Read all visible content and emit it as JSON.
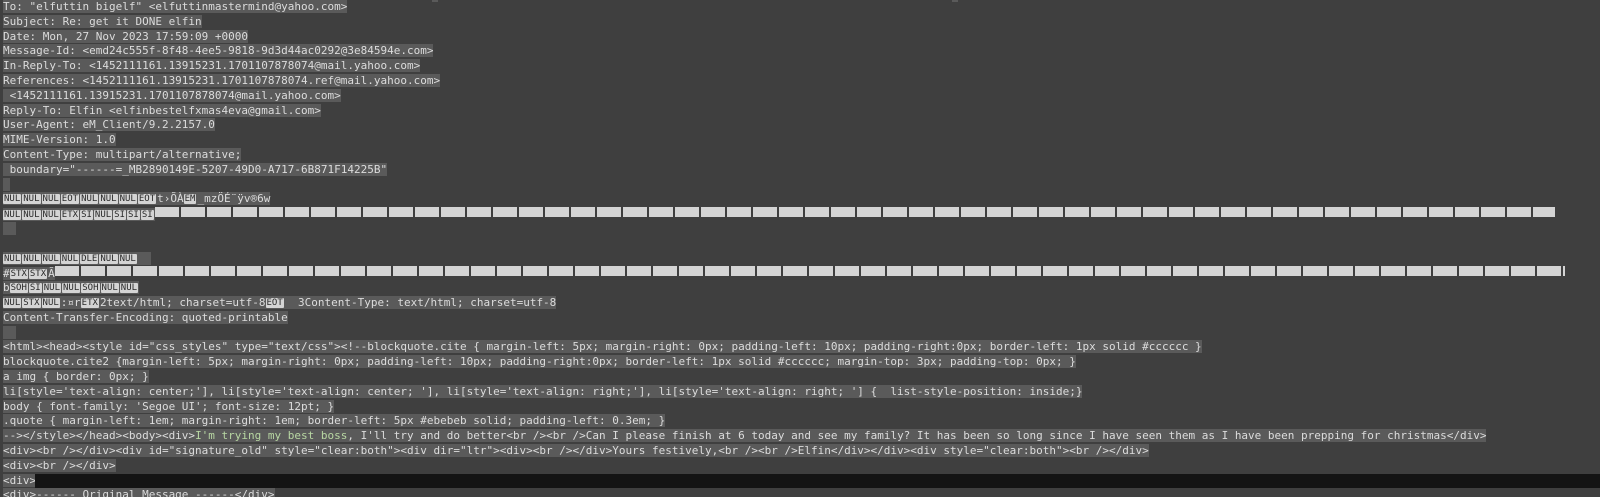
{
  "headers": [
    "To: \"elfuttin bigelf\" <elfuttinmastermind@yahoo.com>",
    "Subject: Re: get it DONE elfin",
    "Date: Mon, 27 Nov 2023 17:59:09 +0000",
    "Message-Id: <emd24c555f-8f48-4ee5-9818-9d3d44ac0292@3e84594e.com>",
    "In-Reply-To: <1452111161.13915231.1701107878074@mail.yahoo.com>",
    "References: <1452111161.13915231.1701107878074.ref@mail.yahoo.com>",
    " <1452111161.13915231.1701107878074@mail.yahoo.com>",
    "Reply-To: Elfin <elfinbestelfxmas4eva@gmail.com>",
    "User-Agent: eM_Client/9.2.2157.0",
    "MIME-Version: 1.0",
    "Content-Type: multipart/alternative;",
    " boundary=\"------=_MB2890149E-5207-49D0-A717-6B871F14225B\""
  ],
  "binary": {
    "row1_codes": [
      "NUL",
      "NUL",
      "NUL",
      "EOT",
      "NUL",
      "NUL",
      "NUL",
      "EOT"
    ],
    "row1_text": "t›ÕÀ",
    "row1_code2": "EM",
    "row1_tail": "_mzÖÉ¨ÿv®6w",
    "row2_codes": [
      "NUL",
      "NUL",
      "NUL",
      "ETX",
      "SI",
      "NUL",
      "SI",
      "SI",
      "SI"
    ],
    "row2_mid": "ì",
    "row4_codes": [
      "NUL",
      "NUL",
      "NUL",
      "NUL",
      "DLE",
      "NUL",
      "NUL"
    ],
    "row5_prefix": "#",
    "row5_codes": [
      "STX",
      "STX"
    ],
    "row5_mid": "Ã",
    "row6_prefix": "b",
    "row6_codes": [
      "SOH",
      "SI",
      "NUL",
      "NUL",
      "SOH",
      "NUL",
      "NUL"
    ],
    "row7_codes": [
      "NUL",
      "STX",
      "NUL"
    ],
    "row7_text1": ":¤r",
    "row7_code2": "ETX",
    "row7_text2": "2text/html; charset=utf-8",
    "row7_code3": "EOT",
    "row7_text3": "  3Content-Type: text/html; charset=utf-8"
  },
  "cte": "Content-Transfer-Encoding: quoted-printable",
  "html_lines": [
    "<html><head><style id=\"css_styles\" type=\"text/css\"><!--blockquote.cite { margin-left: 5px; margin-right: 0px; padding-left: 10px; padding-right:0px; border-left: 1px solid #cccccc }",
    "blockquote.cite2 {margin-left: 5px; margin-right: 0px; padding-left: 10px; padding-right:0px; border-left: 1px solid #cccccc; margin-top: 3px; padding-top: 0px; }",
    "a img { border: 0px; }",
    "li[style='text-align: center;'], li[style='text-align: center; '], li[style='text-align: right;'], li[style='text-align: right; '] {  list-style-position: inside;}",
    "body { font-family: 'Segoe UI'; font-size: 12pt; }",
    ".quote { margin-left: 1em; margin-right: 1em; border-left: 5px #ebebeb solid; padding-left: 0.3em; }"
  ],
  "body_line": {
    "prefix": "--></style></head><body><div>",
    "highlight": "I'm trying my best boss",
    "suffix": ", I'll try and do better<br /><br />Can I please finish at 6 today and see my family? It has been so long since I have seen them as I have been prepping for christmas</div>"
  },
  "trailer_lines": [
    "<div><br /></div><div id=\"signature_old\" style=\"clear:both\"><div dir=\"ltr\"><div><br /></div>Yours festively,<br /><br />Elfin</div></div><div style=\"clear:both\"><br /></div>",
    "<div><br /></div>"
  ],
  "cursor_line": "<div>",
  "last_line": "<div>------ Original Message ------</div>",
  "colors": {
    "background": "#3f3f3f",
    "selection": "#5a5a5a",
    "text": "#dcdcdc",
    "highlight_text": "#b8d7a3",
    "cursor_line": "#141414"
  }
}
